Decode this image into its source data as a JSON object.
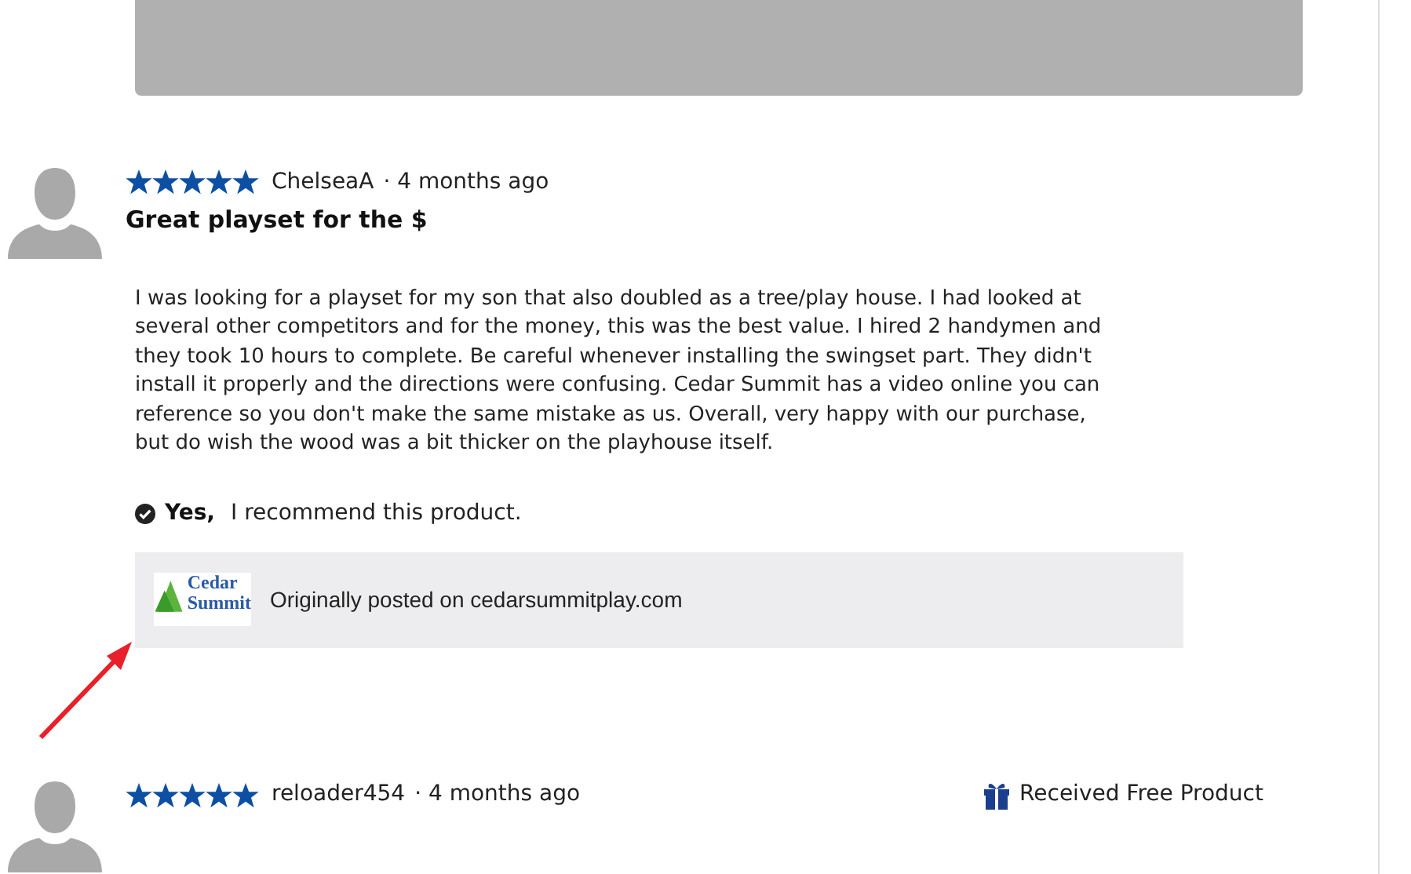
{
  "reviews": [
    {
      "stars": 5,
      "author": "ChelseaA",
      "time": "· 4 months ago",
      "title": "Great playset for the $",
      "body": "I was looking for a playset for my son that also doubled as a tree/play house. I had looked at several other competitors and for the money, this was the best value. I hired 2 handymen and they took 10 hours to complete. Be careful whenever installing the swingset part. They didn't install it properly and the directions were confusing. Cedar Summit has a video online you can reference so you don't make the same mistake as us. Overall, very happy with our purchase, but do wish the wood was a bit thicker on the playhouse itself.",
      "recommend": {
        "answer": "Yes,",
        "text": "I recommend this product."
      },
      "source": {
        "logo_lines": [
          "Cedar",
          "Summit"
        ],
        "text": "Originally posted on cedarsummitplay.com"
      }
    },
    {
      "stars": 5,
      "author": "reloader454",
      "time": "· 4 months ago",
      "badge": "Received Free Product"
    }
  ]
}
